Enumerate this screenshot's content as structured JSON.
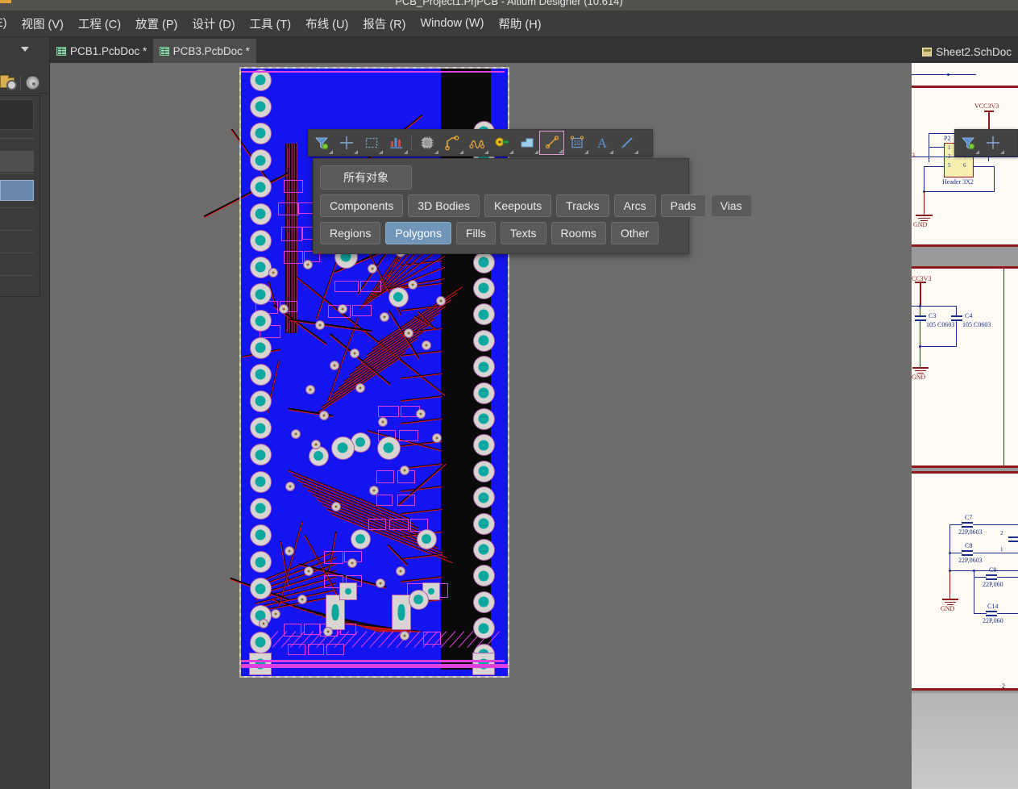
{
  "window": {
    "title": "PCB_Project1.PrjPCB - Altium Designer (10.614)"
  },
  "menubar": {
    "items": [
      {
        "label": "E)"
      },
      {
        "label": "视图 (V)"
      },
      {
        "label": "工程 (C)"
      },
      {
        "label": "放置 (P)"
      },
      {
        "label": "设计 (D)"
      },
      {
        "label": "工具 (T)"
      },
      {
        "label": "布线 (U)"
      },
      {
        "label": "报告 (R)"
      },
      {
        "label": "Window (W)"
      },
      {
        "label": "帮助 (H)"
      }
    ]
  },
  "tabs": {
    "left": [
      {
        "label": "PCB1.PcbDoc *",
        "active": false,
        "icon": "pcb-doc-icon"
      },
      {
        "label": "PCB3.PcbDoc *",
        "active": true,
        "icon": "pcb-doc-icon"
      }
    ],
    "right": [
      {
        "label": "Sheet2.SchDoc",
        "active": false,
        "icon": "sch-doc-icon"
      }
    ]
  },
  "pcb_toolbar": {
    "name": "pcb-active-bar",
    "buttons": [
      {
        "name": "selection-filter-icon",
        "title": "Selection Filter"
      },
      {
        "name": "crosshair-icon",
        "title": "Place Crosshair"
      },
      {
        "name": "marquee-select-icon",
        "title": "Area Select"
      },
      {
        "name": "layer-stack-icon",
        "title": "Layer Stack"
      },
      {
        "name": "component-chip-icon",
        "title": "Place Component"
      },
      {
        "name": "route-track-icon",
        "title": "Interactive Routing"
      },
      {
        "name": "differential-pair-icon",
        "title": "Differential Pair Routing"
      },
      {
        "name": "via-pad-icon",
        "title": "Place Pad / Via"
      },
      {
        "name": "polygon-pour-icon",
        "title": "Place Polygon Pour"
      },
      {
        "name": "dimension-line-icon",
        "title": "Place Dimension",
        "selected": true
      },
      {
        "name": "dimension-value-icon",
        "title": "Linear Dimension",
        "label": "10"
      },
      {
        "name": "place-string-icon",
        "title": "Place String",
        "label": "A"
      },
      {
        "name": "place-line-icon",
        "title": "Place Line"
      }
    ]
  },
  "object_filter_menu": {
    "name": "selection-filter-popup",
    "all_objects_label": "所有对象",
    "rows": [
      [
        "Components",
        "3D Bodies",
        "Keepouts",
        "Tracks",
        "Arcs",
        "Pads",
        "Vias"
      ],
      [
        "Regions",
        "Polygons",
        "Fills",
        "Texts",
        "Rooms",
        "Other"
      ]
    ],
    "active": "Polygons",
    "accent_color": "#6f96b8"
  },
  "schematic_panel": {
    "page_number": "2",
    "sheet1": {
      "designator": "P2",
      "part_name": "Header 3X2",
      "power_net": "VCC3V3",
      "gnd_net": "GND",
      "pins": [
        "1",
        "2",
        "3",
        "4",
        "5",
        "6"
      ]
    },
    "sheet2": {
      "power_net": "CC3V3",
      "gnd_net": "GND",
      "caps": [
        {
          "designator": "C3",
          "value": "105 C0603"
        },
        {
          "designator": "C4",
          "value": "105 C0603"
        }
      ]
    },
    "sheet3": {
      "gnd_net": "GND",
      "caps": [
        {
          "designator": "C7",
          "value": "22P,0603"
        },
        {
          "designator": "C8",
          "value": "22P,0603"
        },
        {
          "designator": "C9",
          "value": "22P,060"
        },
        {
          "designator": "C14",
          "value": "22P,060"
        }
      ],
      "crystal_pins": [
        "2",
        "1"
      ]
    }
  },
  "pcb_board": {
    "name": "pcb3-board-view",
    "layer_colors": {
      "top_copper_pour": "#1414f0",
      "top_track": "#e01818",
      "bottom_track": "#080808",
      "silkscreen": "#e040e0",
      "pad_ring": "#d8d4d1",
      "pad_hole": "#0fa8a0",
      "board_outline": "#d7d3d0"
    },
    "left_pad_count": 22,
    "right_pad_count": 21
  }
}
